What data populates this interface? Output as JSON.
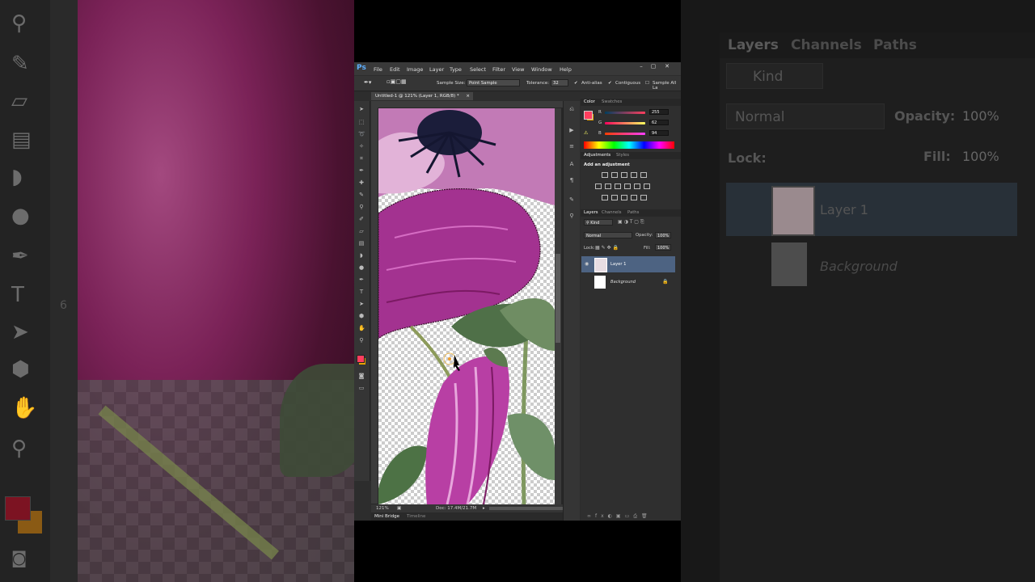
{
  "window": {
    "menu": [
      "File",
      "Edit",
      "Image",
      "Layer",
      "Type",
      "Select",
      "Filter",
      "View",
      "Window",
      "Help"
    ],
    "ps_logo": "Ps"
  },
  "options_bar": {
    "sample_size_label": "Sample Size:",
    "sample_size_value": "Point Sample",
    "tolerance_label": "Tolerance:",
    "tolerance_value": "32",
    "anti_alias_label": "Anti-alias",
    "contiguous_label": "Contiguous",
    "sample_all_label": "Sample All La"
  },
  "document": {
    "tab_title": "Untitled-1 @ 121% (Layer 1, RGB/8) *",
    "zoom": "121%",
    "doc_info": "Doc: 17.4M/21.7M",
    "bottom_tabs": [
      "Mini Bridge",
      "Timeline"
    ]
  },
  "color_panel": {
    "tabs": [
      "Color",
      "Swatches"
    ],
    "channels": [
      {
        "label": "R",
        "value": "255"
      },
      {
        "label": "G",
        "value": "62"
      },
      {
        "label": "B",
        "value": "94"
      }
    ],
    "foreground": "#ff3e5e",
    "background": "#e8a200"
  },
  "adjustments_panel": {
    "tabs": [
      "Adjustments",
      "Styles"
    ],
    "heading": "Add an adjustment"
  },
  "layers_panel": {
    "tabs": [
      "Layers",
      "Channels",
      "Paths"
    ],
    "kind": "Kind",
    "blend_mode": "Normal",
    "opacity_label": "Opacity:",
    "opacity_value": "100%",
    "lock_label": "Lock:",
    "fill_label": "Fill:",
    "fill_value": "100%",
    "layers": [
      {
        "name": "Layer 1",
        "selected": true,
        "visible": true
      },
      {
        "name": "Background",
        "selected": false,
        "locked": true
      }
    ]
  },
  "background_overlay": {
    "tabs": [
      "Layers",
      "Channels",
      "Paths"
    ],
    "kind": "Kind",
    "blend_mode": "Normal",
    "opacity_label": "Opacity:",
    "opacity_value": "100%",
    "lock_label": "Lock:",
    "fill_label": "Fill:",
    "fill_value": "100%",
    "layers": [
      "Layer 1",
      "Background"
    ],
    "ruler_number": "6"
  }
}
